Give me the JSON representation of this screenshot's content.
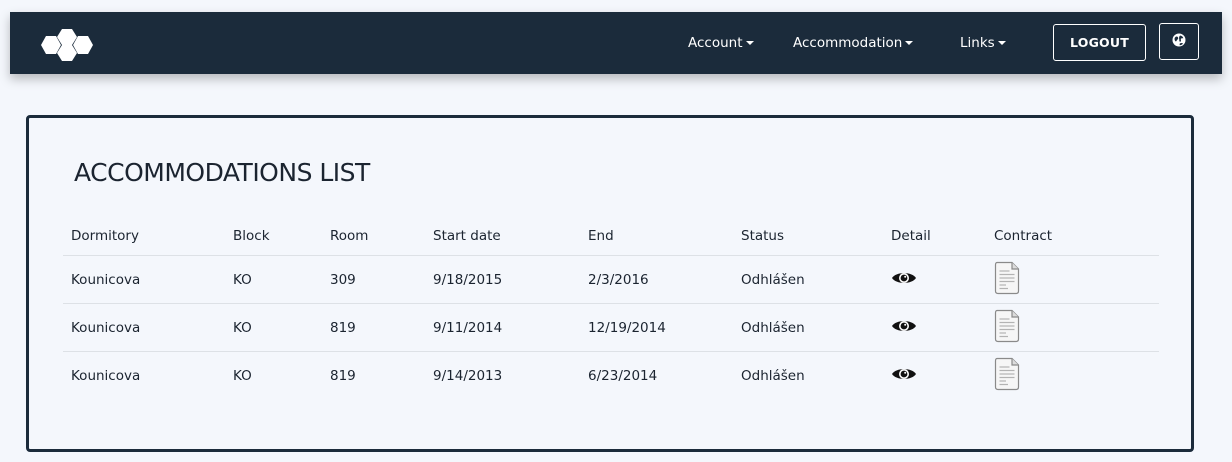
{
  "nav": {
    "items": [
      {
        "label": "Account"
      },
      {
        "label": "Accommodation"
      },
      {
        "label": "Links"
      }
    ],
    "logout_label": "LOGOUT",
    "language_icon": "globe-icon",
    "logo_icon": "hexagon-cluster-logo"
  },
  "main": {
    "title": "ACCOMMODATIONS LIST",
    "table": {
      "headers": [
        "Dormitory",
        "Block",
        "Room",
        "Start date",
        "End",
        "Status",
        "Detail",
        "Contract"
      ],
      "rows": [
        {
          "dormitory": "Kounicova",
          "block": "KO",
          "room": "309",
          "start": "9/18/2015",
          "end": "2/3/2016",
          "status": "Odhlášen",
          "detail_icon": "eye-icon",
          "contract_icon": "document-icon"
        },
        {
          "dormitory": "Kounicova",
          "block": "KO",
          "room": "819",
          "start": "9/11/2014",
          "end": "12/19/2014",
          "status": "Odhlášen",
          "detail_icon": "eye-icon",
          "contract_icon": "document-icon"
        },
        {
          "dormitory": "Kounicova",
          "block": "KO",
          "room": "819",
          "start": "9/14/2013",
          "end": "6/23/2014",
          "status": "Odhlášen",
          "detail_icon": "eye-icon",
          "contract_icon": "document-icon"
        }
      ]
    }
  },
  "colors": {
    "navbar_bg": "#1b2b3b",
    "page_bg": "#f4f7fc",
    "text": "#1b2430",
    "row_border": "#dde1e6"
  }
}
